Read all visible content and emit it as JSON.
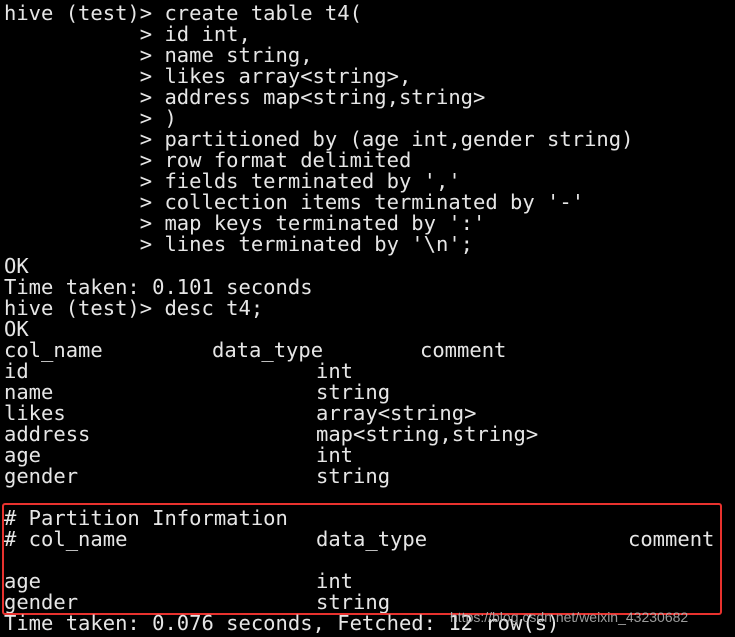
{
  "terminal": {
    "colors": {
      "background": "#000000",
      "text": "#e6e6e6",
      "highlight_border": "#e8322e",
      "watermark": "#b9b9b9"
    },
    "create_lines": [
      "hive (test)> create table t4(",
      "           > id int,",
      "           > name string,",
      "           > likes array<string>,",
      "           > address map<string,string>",
      "           > )",
      "           > partitioned by (age int,gender string)",
      "           > row format delimited",
      "           > fields terminated by ','",
      "           > collection items terminated by '-'",
      "           > map keys terminated by ':'",
      "           > lines terminated by '\\n';"
    ],
    "ok_1": "OK",
    "time_1": "Time taken: 0.101 seconds",
    "desc_cmd": "hive (test)> desc t4;",
    "ok_2": "OK",
    "desc_header": {
      "col_name": "col_name",
      "data_type": "data_type",
      "comment": "comment"
    },
    "desc_rows": [
      {
        "name": "id",
        "type": "int"
      },
      {
        "name": "name",
        "type": "string"
      },
      {
        "name": "likes",
        "type": "array<string>"
      },
      {
        "name": "address",
        "type": "map<string,string>"
      },
      {
        "name": "age",
        "type": "int"
      },
      {
        "name": "gender",
        "type": "string"
      }
    ],
    "partition_info": {
      "title": "# Partition Information",
      "col_name": "# col_name",
      "data_type": "data_type",
      "comment": "comment",
      "rows": [
        {
          "name": "age",
          "type": "int"
        },
        {
          "name": "gender",
          "type": "string"
        }
      ]
    },
    "time_2": "Time taken: 0.076 seconds, Fetched: 12 row(s)",
    "watermark": "https://blog.csdn.net/weixin_43230682"
  }
}
